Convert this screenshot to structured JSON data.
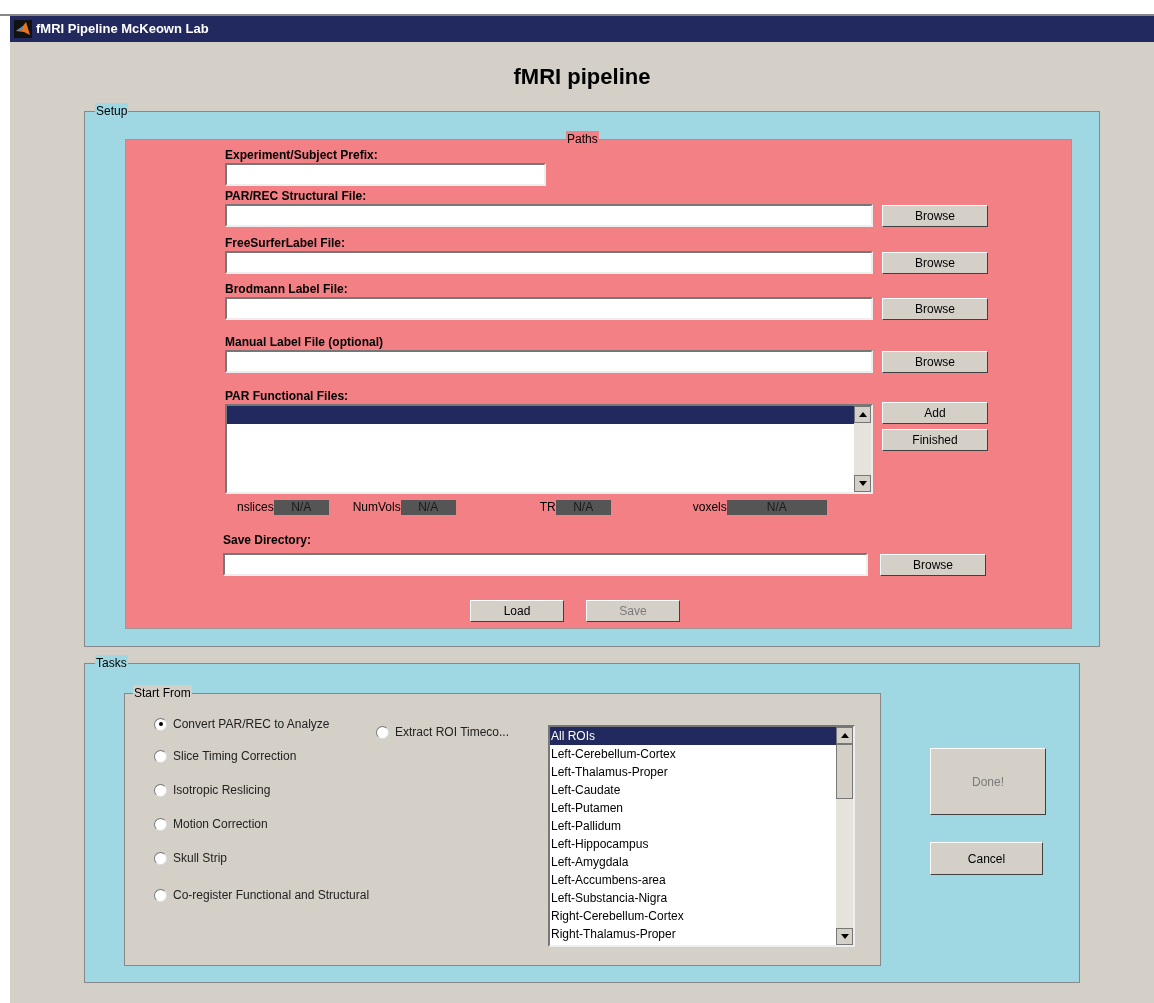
{
  "window": {
    "title": "fMRI Pipeline McKeown Lab"
  },
  "heading": "fMRI pipeline",
  "setup": {
    "legend": "Setup",
    "paths": {
      "legend": "Paths",
      "fields": [
        {
          "label": "Experiment/Subject Prefix:",
          "kind": "short"
        },
        {
          "label": "PAR/REC Structural File:",
          "kind": "browse",
          "button": "Browse"
        },
        {
          "label": "FreeSurferLabel File:",
          "kind": "browse",
          "button": "Browse"
        },
        {
          "label": "Brodmann Label File:",
          "kind": "browse",
          "button": "Browse"
        },
        {
          "label": "Manual Label File (optional)",
          "kind": "browse",
          "button": "Browse"
        }
      ],
      "functional_files": {
        "label": "PAR Functional Files:",
        "rows": [
          {
            "selected": true
          }
        ],
        "buttons": [
          "Add",
          "Finished"
        ]
      },
      "info": [
        {
          "label": "nslices",
          "value": "N/A"
        },
        {
          "label": "NumVols",
          "value": "N/A"
        },
        {
          "label": "TR",
          "value": "N/A"
        },
        {
          "label": "voxels",
          "value": "N/A"
        }
      ],
      "save_directory": {
        "label": "Save Directory:",
        "button": "Browse"
      },
      "actions": [
        {
          "label": "Load",
          "disabled": false
        },
        {
          "label": "Save",
          "disabled": true
        }
      ]
    }
  },
  "tasks": {
    "legend": "Tasks",
    "start_from": {
      "legend": "Start From",
      "options": [
        {
          "label": "Convert PAR/REC to Analyze",
          "selected": true
        },
        {
          "label": "Extract ROI Timeco...",
          "selected": false
        },
        {
          "label": "Slice Timing Correction",
          "selected": false
        },
        {
          "label": "Isotropic Reslicing",
          "selected": false
        },
        {
          "label": "Motion Correction",
          "selected": false
        },
        {
          "label": "Skull Strip",
          "selected": false
        },
        {
          "label": "Co-register Functional and Structural",
          "selected": false
        }
      ],
      "roi_list": [
        {
          "label": "All ROIs",
          "selected": true
        },
        {
          "label": "Left-Cerebellum-Cortex",
          "selected": false
        },
        {
          "label": "Left-Thalamus-Proper",
          "selected": false
        },
        {
          "label": "Left-Caudate",
          "selected": false
        },
        {
          "label": "Left-Putamen",
          "selected": false
        },
        {
          "label": "Left-Pallidum",
          "selected": false
        },
        {
          "label": "Left-Hippocampus",
          "selected": false
        },
        {
          "label": "Left-Amygdala",
          "selected": false
        },
        {
          "label": "Left-Accumbens-area",
          "selected": false
        },
        {
          "label": "Left-Substancia-Nigra",
          "selected": false
        },
        {
          "label": "Right-Cerebellum-Cortex",
          "selected": false
        },
        {
          "label": "Right-Thalamus-Proper",
          "selected": false
        }
      ]
    },
    "buttons": [
      {
        "label": "Done!",
        "disabled": true
      },
      {
        "label": "Cancel",
        "disabled": false
      }
    ]
  }
}
